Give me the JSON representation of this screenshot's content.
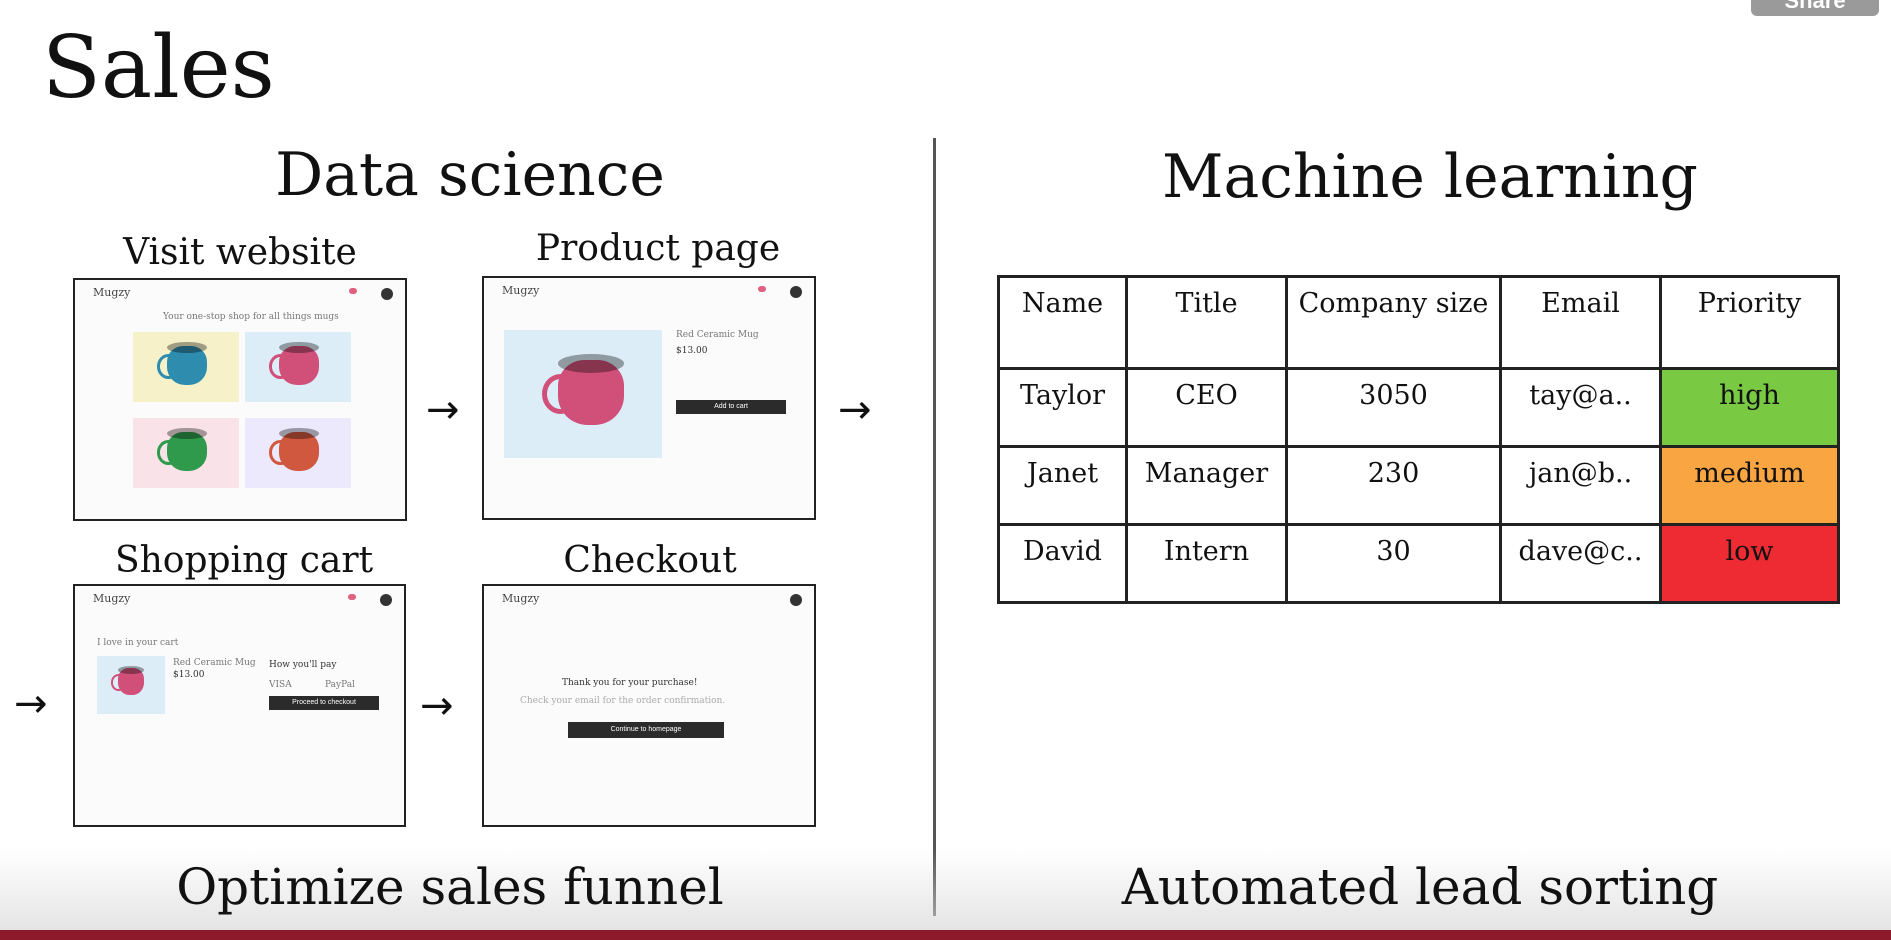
{
  "header": {
    "title": "Sales",
    "share_label": "Share"
  },
  "left": {
    "title": "Data science",
    "caption": "Optimize sales funnel",
    "steps": [
      {
        "label": "Visit website"
      },
      {
        "label": "Product page"
      },
      {
        "label": "Shopping cart"
      },
      {
        "label": "Checkout"
      }
    ],
    "screens": {
      "brand": "Mugzy",
      "visit": {
        "tagline": "Your one-stop shop for all things mugs"
      },
      "product": {
        "name": "Red Ceramic Mug",
        "price": "$13.00",
        "button": "Add to cart"
      },
      "cart": {
        "heading": "I love in your cart",
        "item": "Red Ceramic Mug",
        "price": "$13.00",
        "pay_heading": "How you'll pay",
        "option_visa": "VISA",
        "option_paypal": "PayPal",
        "button": "Proceed to checkout"
      },
      "checkout": {
        "thanks": "Thank you for your purchase!",
        "note": "Check your email for the order confirmation.",
        "button": "Continue to homepage"
      }
    },
    "mug_colors": [
      "#2e8cae",
      "#d0507a",
      "#2f9a4c",
      "#d0583e"
    ],
    "tile_colors": [
      "#f6f1c9",
      "#dcedf7",
      "#f9e3e8",
      "#ebe9fb"
    ]
  },
  "right": {
    "title": "Machine learning",
    "caption": "Automated lead sorting",
    "table": {
      "headers": [
        "Name",
        "Title",
        "Company size",
        "Email",
        "Priority"
      ],
      "rows": [
        {
          "name": "Taylor",
          "title": "CEO",
          "size": "3050",
          "email": "tay@a..",
          "priority": "high",
          "color": "#7ac943"
        },
        {
          "name": "Janet",
          "title": "Manager",
          "size": "230",
          "email": "jan@b..",
          "priority": "medium",
          "color": "#f9a541"
        },
        {
          "name": "David",
          "title": "Intern",
          "size": "30",
          "email": "dave@c..",
          "priority": "low",
          "color": "#ee2a32"
        }
      ]
    }
  },
  "colors": {
    "accent_bar": "#8c1a2b"
  }
}
